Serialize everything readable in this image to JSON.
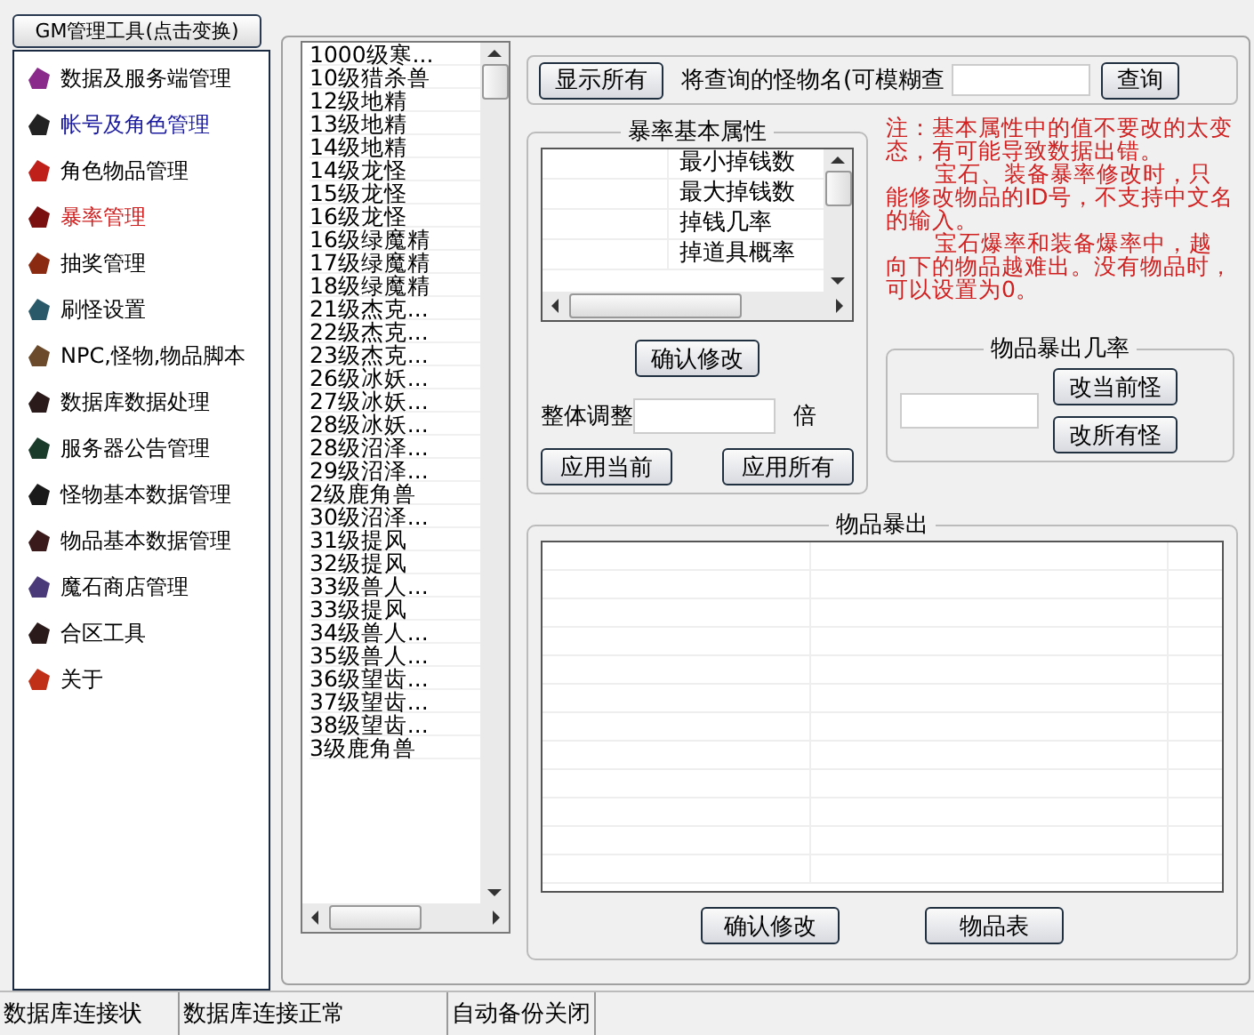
{
  "sidebar": {
    "header_button": "GM管理工具(点击变换)",
    "items": [
      {
        "label": "数据及服务端管理",
        "selected": false,
        "hot": false
      },
      {
        "label": "帐号及角色管理",
        "selected": false,
        "hot": true
      },
      {
        "label": "角色物品管理",
        "selected": false,
        "hot": false
      },
      {
        "label": "暴率管理",
        "selected": true,
        "hot": false
      },
      {
        "label": "抽奖管理",
        "selected": false,
        "hot": false
      },
      {
        "label": "刷怪设置",
        "selected": false,
        "hot": false
      },
      {
        "label": "NPC,怪物,物品脚本",
        "selected": false,
        "hot": false
      },
      {
        "label": "数据库数据处理",
        "selected": false,
        "hot": false
      },
      {
        "label": "服务器公告管理",
        "selected": false,
        "hot": false
      },
      {
        "label": "怪物基本数据管理",
        "selected": false,
        "hot": false
      },
      {
        "label": "物品基本数据管理",
        "selected": false,
        "hot": false
      },
      {
        "label": "魔石商店管理",
        "selected": false,
        "hot": false
      },
      {
        "label": "合区工具",
        "selected": false,
        "hot": false
      },
      {
        "label": "关于",
        "selected": false,
        "hot": false
      }
    ]
  },
  "monster_list": {
    "items": [
      "1000级寒...",
      "10级猎杀兽",
      "12级地精",
      "13级地精",
      "14级地精",
      "14级龙怪",
      "15级龙怪",
      "16级龙怪",
      "16级绿魔精",
      "17级绿魔精",
      "18级绿魔精",
      "21级杰克...",
      "22级杰克...",
      "23级杰克...",
      "26级冰妖...",
      "27级冰妖...",
      "28级冰妖...",
      "28级沼泽...",
      "29级沼泽...",
      "2级鹿角兽",
      "30级沼泽...",
      "31级提风",
      "32级提风",
      "33级兽人...",
      "33级提风",
      "34级兽人...",
      "35级兽人...",
      "36级望齿...",
      "37级望齿...",
      "38级望齿...",
      "3级鹿角兽"
    ]
  },
  "search": {
    "show_all_button": "显示所有",
    "label": "将查询的怪物名(可模糊查",
    "query_button": "查询"
  },
  "drop_attributes": {
    "title": "暴率基本属性",
    "rows": [
      "最小掉钱数",
      "最大掉钱数",
      "掉钱几率",
      "掉道具概率"
    ],
    "confirm_button": "确认修改",
    "adjust_label": "整体调整",
    "adjust_unit": "倍",
    "buttons": [
      "应用当前",
      "应用所有"
    ]
  },
  "note": {
    "paragraphs": [
      "注：基本属性中的值不要改的太变态，有可能导致数据出错。",
      "宝石、装备暴率修改时，只能修改物品的ID号，不支持中文名的输入。",
      "宝石爆率和装备爆率中，越向下的物品越难出。没有物品时，可以设置为0。"
    ]
  },
  "item_drop_rate": {
    "title": "物品暴出几率",
    "buttons": [
      "改当前怪",
      "改所有怪"
    ]
  },
  "item_drops": {
    "title": "物品暴出",
    "buttons": [
      "确认修改",
      "物品表"
    ]
  },
  "status_bar": [
    "数据库连接状",
    "数据库连接正常",
    "自动备份关闭"
  ]
}
